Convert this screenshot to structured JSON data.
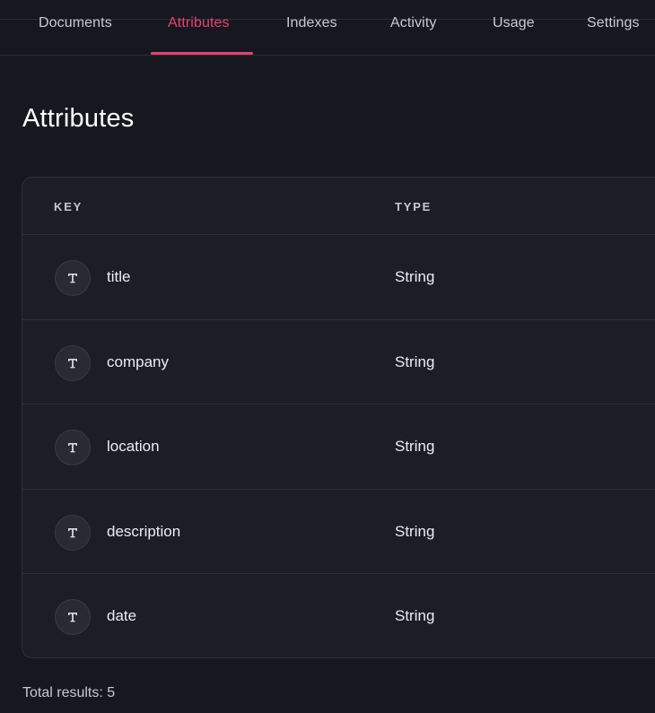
{
  "tabs": [
    {
      "label": "Documents",
      "active": false
    },
    {
      "label": "Attributes",
      "active": true
    },
    {
      "label": "Indexes",
      "active": false
    },
    {
      "label": "Activity",
      "active": false
    },
    {
      "label": "Usage",
      "active": false
    },
    {
      "label": "Settings",
      "active": false
    }
  ],
  "page": {
    "title": "Attributes"
  },
  "table": {
    "headers": {
      "key": "KEY",
      "type": "TYPE"
    },
    "rows": [
      {
        "icon": "text-type-icon",
        "key": "title",
        "type": "String"
      },
      {
        "icon": "text-type-icon",
        "key": "company",
        "type": "String"
      },
      {
        "icon": "text-type-icon",
        "key": "location",
        "type": "String"
      },
      {
        "icon": "text-type-icon",
        "key": "description",
        "type": "String"
      },
      {
        "icon": "text-type-icon",
        "key": "date",
        "type": "String"
      }
    ]
  },
  "footer": {
    "total": "Total results: 5"
  },
  "colors": {
    "accent": "#e44371",
    "background": "#17171f",
    "card": "#1d1d26"
  }
}
